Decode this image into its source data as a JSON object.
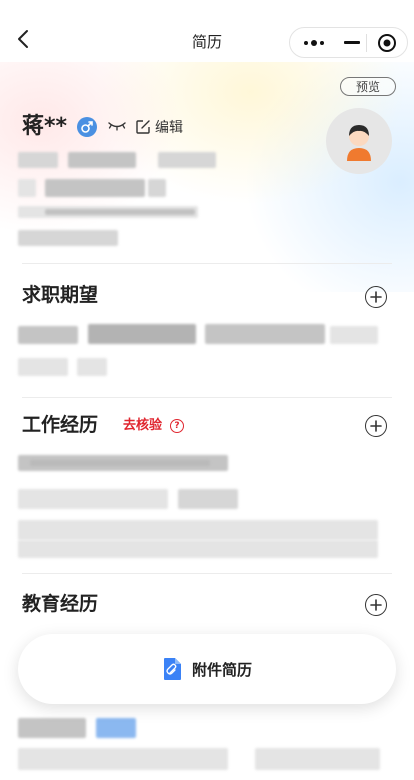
{
  "nav": {
    "title": "简历",
    "more_icon": "more-dots-icon",
    "minimize_icon": "minimize-icon",
    "close_icon": "record-circle-icon",
    "back_icon": "chevron-left-icon"
  },
  "profile": {
    "preview_label": "预览",
    "name": "蒋**",
    "gender_icon": "male-icon",
    "hide_icon": "eye-closed-icon",
    "edit_label": "编辑",
    "avatar_icon": "avatar-icon"
  },
  "sections": {
    "job_expectation": {
      "title": "求职期望",
      "add_icon": "plus-circle-icon"
    },
    "work_experience": {
      "title": "工作经历",
      "verify_label": "去核验",
      "help_icon": "question-circle-icon",
      "add_icon": "plus-circle-icon"
    },
    "education": {
      "title": "教育经历",
      "add_icon": "plus-circle-icon"
    }
  },
  "attachment": {
    "label": "附件简历",
    "icon": "paperclip-file-icon"
  },
  "colors": {
    "accent_blue": "#4a90e2",
    "verify_red": "#e0262f",
    "attach_blue": "#3b82f6"
  }
}
